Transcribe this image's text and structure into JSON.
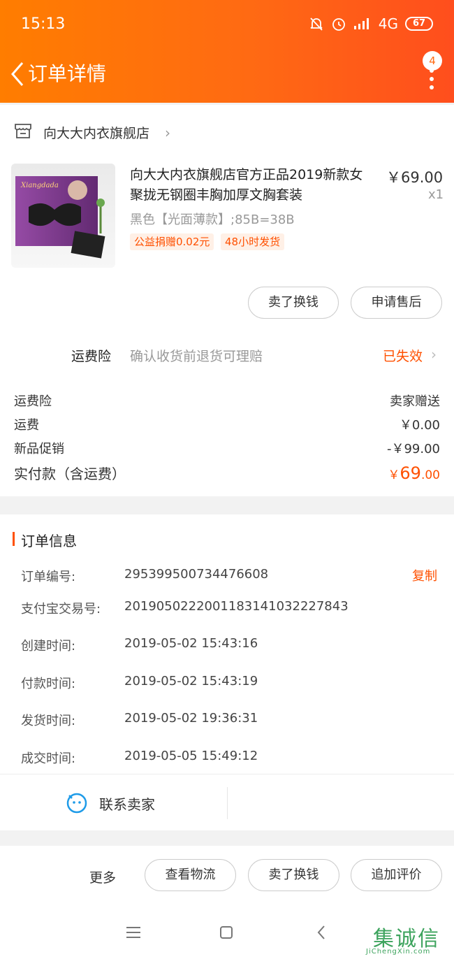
{
  "status_bar": {
    "time": "15:13",
    "network": "4G",
    "battery": "67"
  },
  "nav": {
    "title": "订单详情",
    "badge": "4"
  },
  "shop": {
    "name": "向大大内衣旗舰店"
  },
  "product": {
    "title": "向大大内衣旗舰店官方正品2019新款女聚拢无钢圈丰胸加厚文胸套装",
    "price": "￥69.00",
    "quantity": "x1",
    "sku": "黑色【光面薄款】;85B=38B",
    "tags": [
      "公益捐赠0.02元",
      "48小时发货"
    ],
    "image_text": "Xiangdada"
  },
  "product_actions": {
    "sell": "卖了换钱",
    "after_sale": "申请售后"
  },
  "insurance": {
    "label": "运费险",
    "desc": "确认收货前退货可理赔",
    "status": "已失效"
  },
  "fees": [
    {
      "label": "运费险",
      "value": "卖家赠送"
    },
    {
      "label": "运费",
      "value": "￥0.00"
    },
    {
      "label": "新品促销",
      "value": "-￥99.00"
    }
  ],
  "total": {
    "label": "实付款（含运费）",
    "currency": "￥",
    "int": "69",
    "dec": ".00"
  },
  "order_info": {
    "title": "订单信息",
    "copy_label": "复制",
    "rows": [
      {
        "key": "订单编号:",
        "value": "295399500734476608"
      },
      {
        "key": "支付宝交易号:",
        "value": "2019050222001183141032227843"
      },
      {
        "key": "创建时间:",
        "value": "2019-05-02 15:43:16"
      },
      {
        "key": "付款时间:",
        "value": "2019-05-02 15:43:19"
      },
      {
        "key": "发货时间:",
        "value": "2019-05-02 19:36:31"
      },
      {
        "key": "成交时间:",
        "value": "2019-05-05 15:49:12"
      }
    ],
    "contact": "联系卖家"
  },
  "bottom_actions": {
    "more": "更多",
    "logistics": "查看物流",
    "sell": "卖了换钱",
    "review": "追加评价"
  },
  "watermark": {
    "text": "集诚信",
    "url": "JiChengXin.com"
  },
  "colors": {
    "accent": "#ff5000",
    "header_start": "#ff7d00",
    "header_end": "#ff4e1d"
  }
}
